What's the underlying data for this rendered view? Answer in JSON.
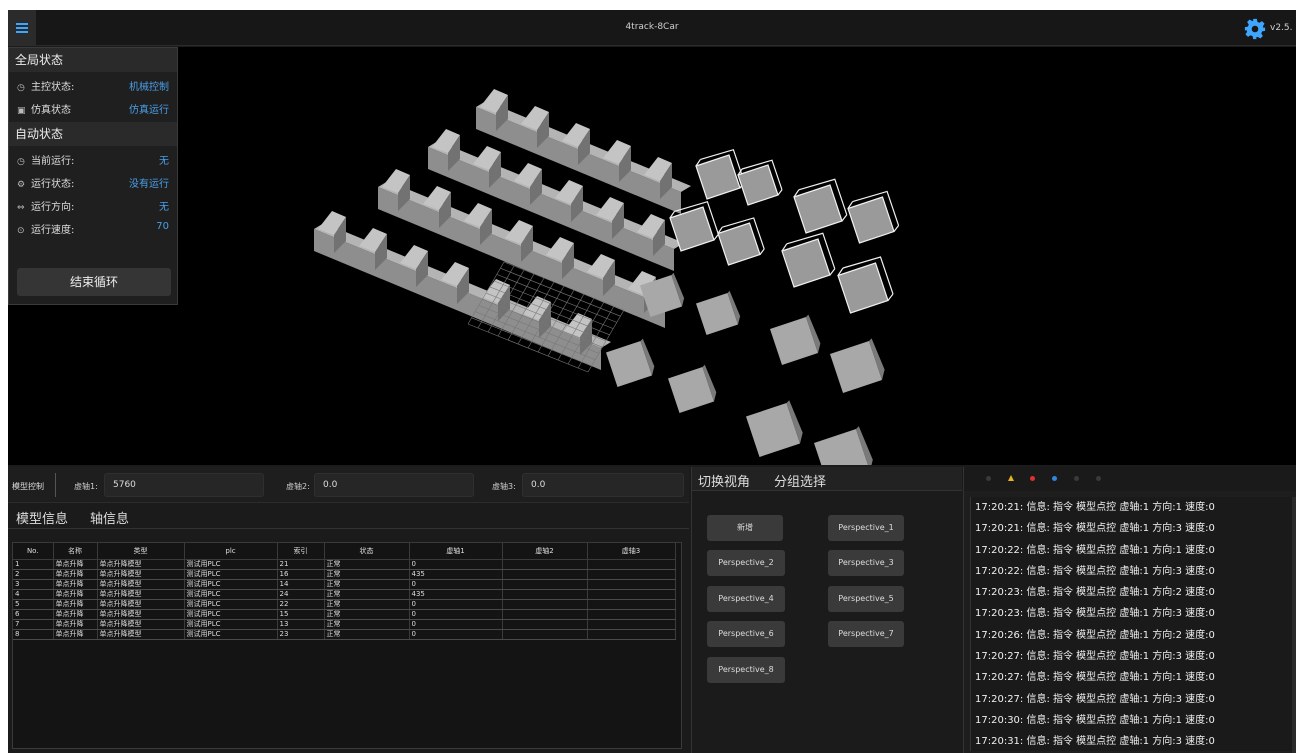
{
  "window": {
    "title": "4track-8Car",
    "version": "v2.5.",
    "accent": "#3fa6ff"
  },
  "global_status": {
    "title": "全局状态",
    "rows": [
      {
        "icon": "clock-icon",
        "label": "主控状态:",
        "value": "机械控制"
      },
      {
        "icon": "monitor-icon",
        "label": "仿真状态",
        "value": "仿真运行"
      }
    ]
  },
  "auto_status": {
    "title": "自动状态",
    "rows": [
      {
        "icon": "clock-icon",
        "label": "当前运行:",
        "value": "无"
      },
      {
        "icon": "gear-small-icon",
        "label": "运行状态:",
        "value": "没有运行"
      },
      {
        "icon": "direction-icon",
        "label": "运行方向:",
        "value": "无"
      },
      {
        "icon": "speed-icon",
        "label": "运行速度:",
        "value": "70"
      }
    ],
    "end_loop_label": "结束循环"
  },
  "model_control": {
    "title": "模型控制",
    "axes": [
      {
        "label": "虚轴1:",
        "value": "5760"
      },
      {
        "label": "虚轴2:",
        "value": "0.0"
      },
      {
        "label": "虚轴3:",
        "value": "0.0"
      }
    ]
  },
  "info_tabs": [
    "模型信息",
    "轴信息"
  ],
  "table": {
    "columns": [
      "No.",
      "名称",
      "类型",
      "plc",
      "索引",
      "状态",
      "虚轴1",
      "虚轴2",
      "虚轴3"
    ],
    "rows": [
      [
        "1",
        "单点升降",
        "单点升降模型",
        "测试用PLC",
        "21",
        "正常",
        "0",
        "",
        ""
      ],
      [
        "2",
        "单点升降",
        "单点升降模型",
        "测试用PLC",
        "16",
        "正常",
        "435",
        "",
        ""
      ],
      [
        "3",
        "单点升降",
        "单点升降模型",
        "测试用PLC",
        "14",
        "正常",
        "0",
        "",
        ""
      ],
      [
        "4",
        "单点升降",
        "单点升降模型",
        "测试用PLC",
        "24",
        "正常",
        "435",
        "",
        ""
      ],
      [
        "5",
        "单点升降",
        "单点升降模型",
        "测试用PLC",
        "22",
        "正常",
        "0",
        "",
        ""
      ],
      [
        "6",
        "单点升降",
        "单点升降模型",
        "测试用PLC",
        "15",
        "正常",
        "0",
        "",
        ""
      ],
      [
        "7",
        "单点升降",
        "单点升降模型",
        "测试用PLC",
        "13",
        "正常",
        "0",
        "",
        ""
      ],
      [
        "8",
        "单点升降",
        "单点升降模型",
        "测试用PLC",
        "23",
        "正常",
        "0",
        "",
        ""
      ]
    ]
  },
  "perspective": {
    "tabs": [
      "切换视角",
      "分组选择"
    ],
    "buttons": [
      "新增",
      "Perspective_1",
      "Perspective_2",
      "Perspective_3",
      "Perspective_4",
      "Perspective_5",
      "Perspective_6",
      "Perspective_7",
      "Perspective_8"
    ]
  },
  "log": {
    "toolbar_colors": [
      "#3a3a3a",
      "#e6b422",
      "#e03030",
      "#2f86e0",
      "#3a3a3a",
      "#3a3a3a"
    ],
    "lines": [
      "17:20:21: 信息: 指令 模型点控 虚轴:1 方向:1 速度:0",
      "17:20:21: 信息: 指令 模型点控 虚轴:1 方向:3 速度:0",
      "17:20:22: 信息: 指令 模型点控 虚轴:1 方向:1 速度:0",
      "17:20:22: 信息: 指令 模型点控 虚轴:1 方向:3 速度:0",
      "17:20:23: 信息: 指令 模型点控 虚轴:1 方向:2 速度:0",
      "17:20:23: 信息: 指令 模型点控 虚轴:1 方向:3 速度:0",
      "17:20:26: 信息: 指令 模型点控 虚轴:1 方向:2 速度:0",
      "17:20:27: 信息: 指令 模型点控 虚轴:1 方向:3 速度:0",
      "17:20:27: 信息: 指令 模型点控 虚轴:1 方向:1 速度:0",
      "17:20:27: 信息: 指令 模型点控 虚轴:1 方向:3 速度:0",
      "17:20:30: 信息: 指令 模型点控 虚轴:1 方向:1 速度:0",
      "17:20:31: 信息: 指令 模型点控 虚轴:1 方向:3 速度:0"
    ]
  }
}
